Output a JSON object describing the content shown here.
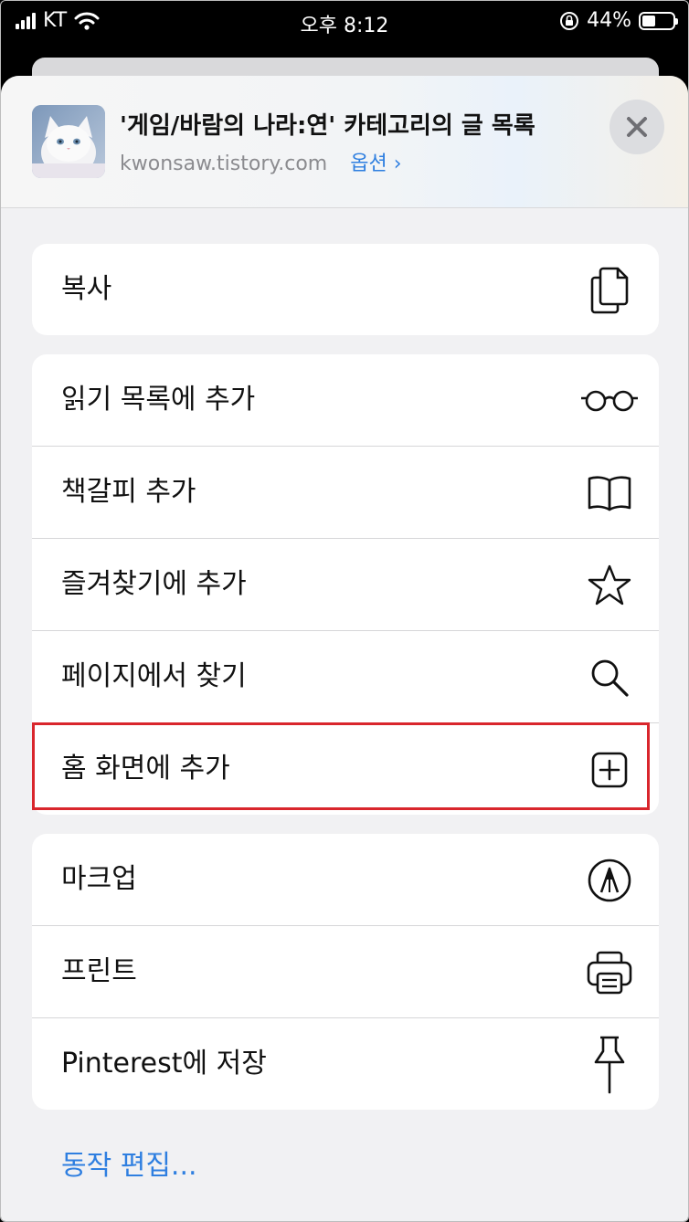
{
  "status_bar": {
    "carrier": "KT",
    "time": "오후 8:12",
    "battery": "44%",
    "battery_level": 0.44
  },
  "share_sheet": {
    "page_title": "'게임/바람의 나라:연' 카테고리의 글 목록",
    "domain": "kwonsaw.tistory.com",
    "options_label": "옵션",
    "options_chevron": "›",
    "close_icon": "close-icon"
  },
  "groups": [
    {
      "items": [
        {
          "label": "복사",
          "icon": "copy-icon"
        }
      ]
    },
    {
      "items": [
        {
          "label": "읽기 목록에 추가",
          "icon": "glasses-icon"
        },
        {
          "label": "책갈피 추가",
          "icon": "book-icon"
        },
        {
          "label": "즐겨찾기에 추가",
          "icon": "star-icon"
        },
        {
          "label": "페이지에서 찾기",
          "icon": "search-icon"
        },
        {
          "label": "홈 화면에 추가",
          "icon": "add-square-icon",
          "highlighted": true
        }
      ]
    },
    {
      "items": [
        {
          "label": "마크업",
          "icon": "markup-icon"
        },
        {
          "label": "프린트",
          "icon": "printer-icon"
        },
        {
          "label": "Pinterest에 저장",
          "icon": "pin-icon"
        }
      ]
    }
  ],
  "edit_actions_label": "동작 편집...",
  "colors": {
    "accent": "#2f7fe0",
    "highlight_border": "#d9262c",
    "sheet_background": "#f1f1f3"
  }
}
